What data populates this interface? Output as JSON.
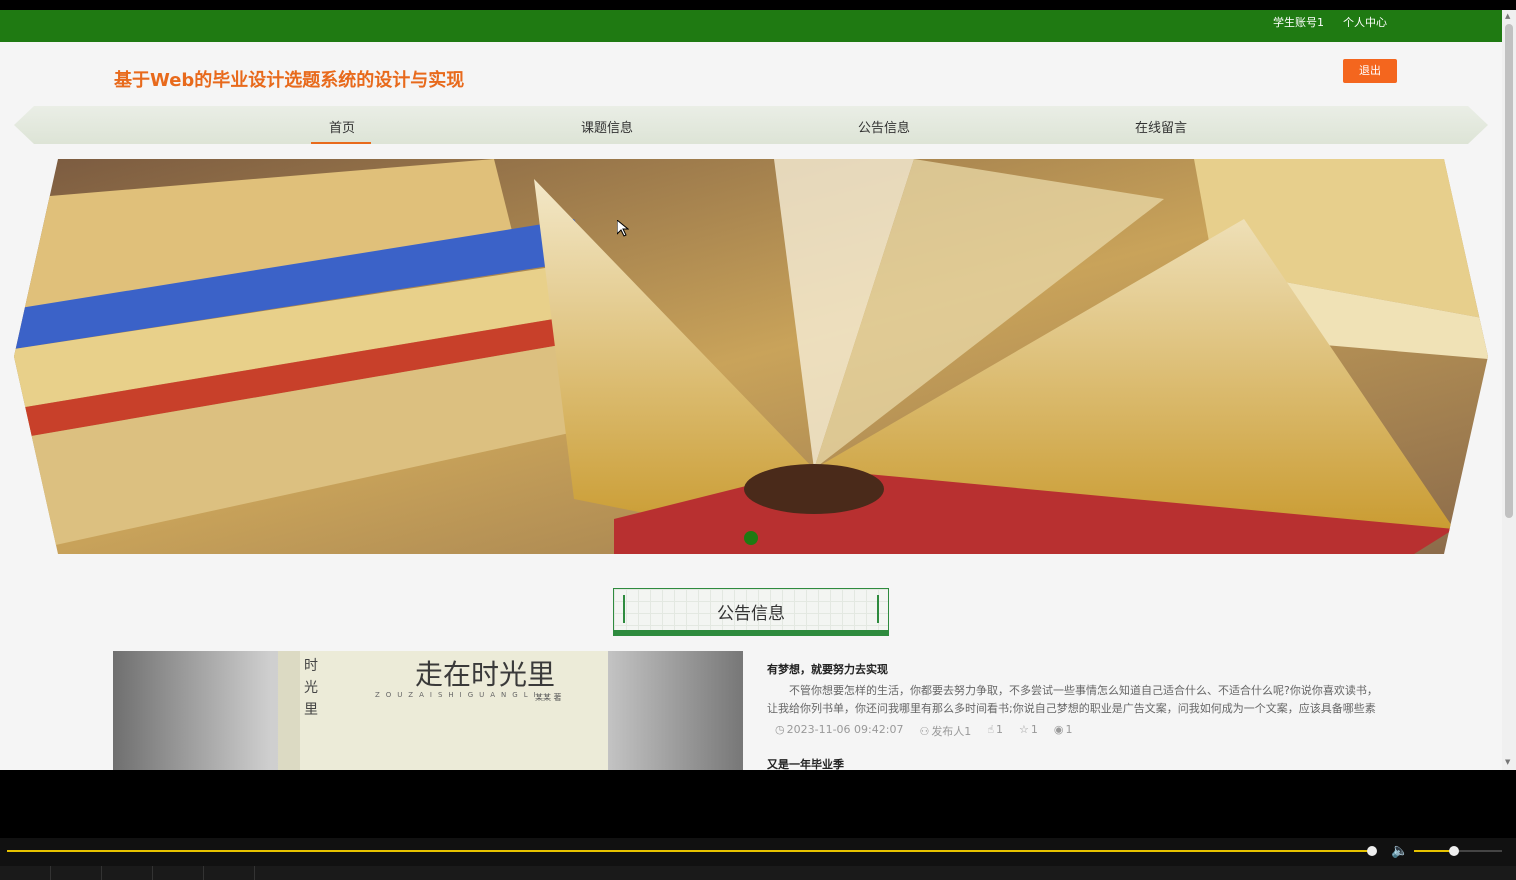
{
  "topbar": {
    "account": "学生账号1",
    "profile": "个人中心"
  },
  "header": {
    "site_title": "基于Web的毕业设计选题系统的设计与实现",
    "logout": "退出"
  },
  "nav": {
    "items": [
      {
        "label": "首页",
        "active": true
      },
      {
        "label": "课题信息",
        "active": false
      },
      {
        "label": "公告信息",
        "active": false
      },
      {
        "label": "在线留言",
        "active": false
      }
    ]
  },
  "section": {
    "title": "公告信息"
  },
  "featured_image": {
    "book_title": "走在时光里",
    "spine_text": "时光里",
    "pinyin": "ZOUZAISHIGUANGLI",
    "author": "某某 著"
  },
  "news": [
    {
      "title": "有梦想，就要努力去实现",
      "desc": "不管你想要怎样的生活，你都要去努力争取，不多尝试一些事情怎么知道自己适合什么、不适合什么呢?你说你喜欢读书，让我给你列书单，你还问我哪里有那么多时间看书;你说自己梦想的职业是广告文案，问我如何成为一个文案，应该具备哪些素",
      "time": "2023-11-06 09:42:07",
      "publisher": "发布人1",
      "likes": "1",
      "favorites": "1",
      "views": "1"
    },
    {
      "title": "又是一年毕业季"
    }
  ],
  "player": {
    "progress": 0.997,
    "volume": 0.45
  },
  "colors": {
    "green": "#1f7a12",
    "orange": "#e86a1c"
  }
}
